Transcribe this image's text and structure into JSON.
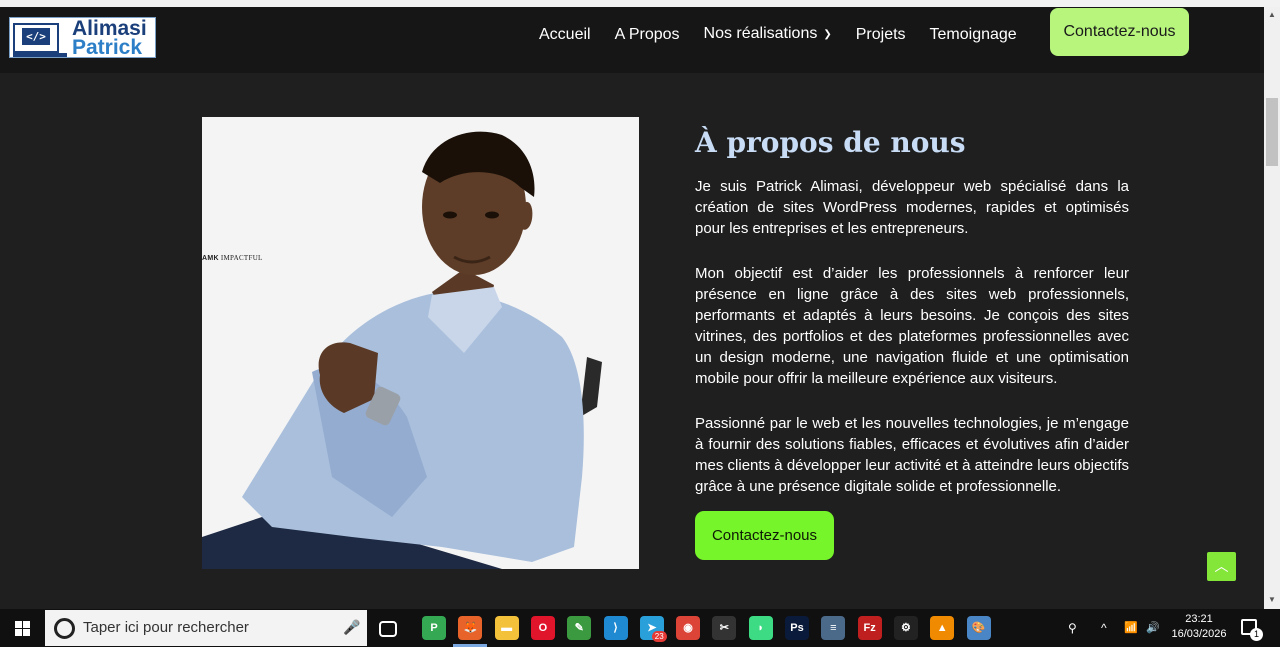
{
  "logo": {
    "icon_text": "</>",
    "line1": "Alimasi",
    "line2": "Patrick"
  },
  "nav": {
    "links": [
      "Accueil",
      "A Propos",
      "Nos réalisations",
      "Projets",
      "Temoignage"
    ],
    "cta": "Contactez-nous"
  },
  "photo": {
    "watermark_bold": "AMK",
    "watermark_rest": " IMPACTFUL"
  },
  "about": {
    "title": "À propos de nous",
    "paragraphs": [
      "Je suis Patrick Alimasi, développeur web spécialisé dans la création de sites WordPress modernes, rapides et optimisés pour les entreprises et les entrepreneurs.",
      "Mon objectif est d’aider les professionnels à renforcer leur présence en ligne grâce à des sites web professionnels, performants et adaptés à leurs besoins. Je conçois des sites vitrines, des portfolios et des plateformes professionnelles avec un design moderne, une navigation fluide et une optimisation mobile pour offrir la meilleure expérience aux visiteurs.",
      "Passionné par le web et les nouvelles technologies, je m’engage à fournir des solutions fiables, efficaces et évolutives afin d’aider mes clients à développer leur activité et à atteindre leurs objectifs grâce à une présence digitale solide et professionnelle."
    ],
    "cta": "Contactez-nous"
  },
  "taskbar": {
    "search_placeholder": "Taper ici pour rechercher",
    "apps": [
      {
        "name": "chrome-profile-icon",
        "label": "P",
        "color": "#34a853"
      },
      {
        "name": "firefox-icon",
        "label": "🦊",
        "color": "#e8632a"
      },
      {
        "name": "file-explorer-icon",
        "label": "▬",
        "color": "#f3c13a"
      },
      {
        "name": "opera-icon",
        "label": "O",
        "color": "#e0142a"
      },
      {
        "name": "notepad-icon",
        "label": "✎",
        "color": "#3b9a3f"
      },
      {
        "name": "vscode-icon",
        "label": "⟩",
        "color": "#1f8ad2"
      },
      {
        "name": "telegram-icon",
        "label": "➤",
        "color": "#2aa0da"
      },
      {
        "name": "chrome-icon",
        "label": "◉",
        "color": "#db4437"
      },
      {
        "name": "capcut-icon",
        "label": "✂",
        "color": "#333333"
      },
      {
        "name": "android-studio-icon",
        "label": "◗",
        "color": "#3ddc84"
      },
      {
        "name": "photoshop-icon",
        "label": "Ps",
        "color": "#0a1a3a"
      },
      {
        "name": "server-icon",
        "label": "≡",
        "color": "#4b6a8a"
      },
      {
        "name": "filezilla-icon",
        "label": "Fz",
        "color": "#bf1f1f"
      },
      {
        "name": "settings-icon",
        "label": "⚙",
        "color": "#222222"
      },
      {
        "name": "vlc-icon",
        "label": "▲",
        "color": "#f08a00"
      },
      {
        "name": "paint-icon",
        "label": "🎨",
        "color": "#4a86c5"
      }
    ],
    "telegram_badge": "23",
    "tray_chevron": "^",
    "time": "23:21",
    "date": "16/03/2026",
    "notification_count": "1"
  }
}
